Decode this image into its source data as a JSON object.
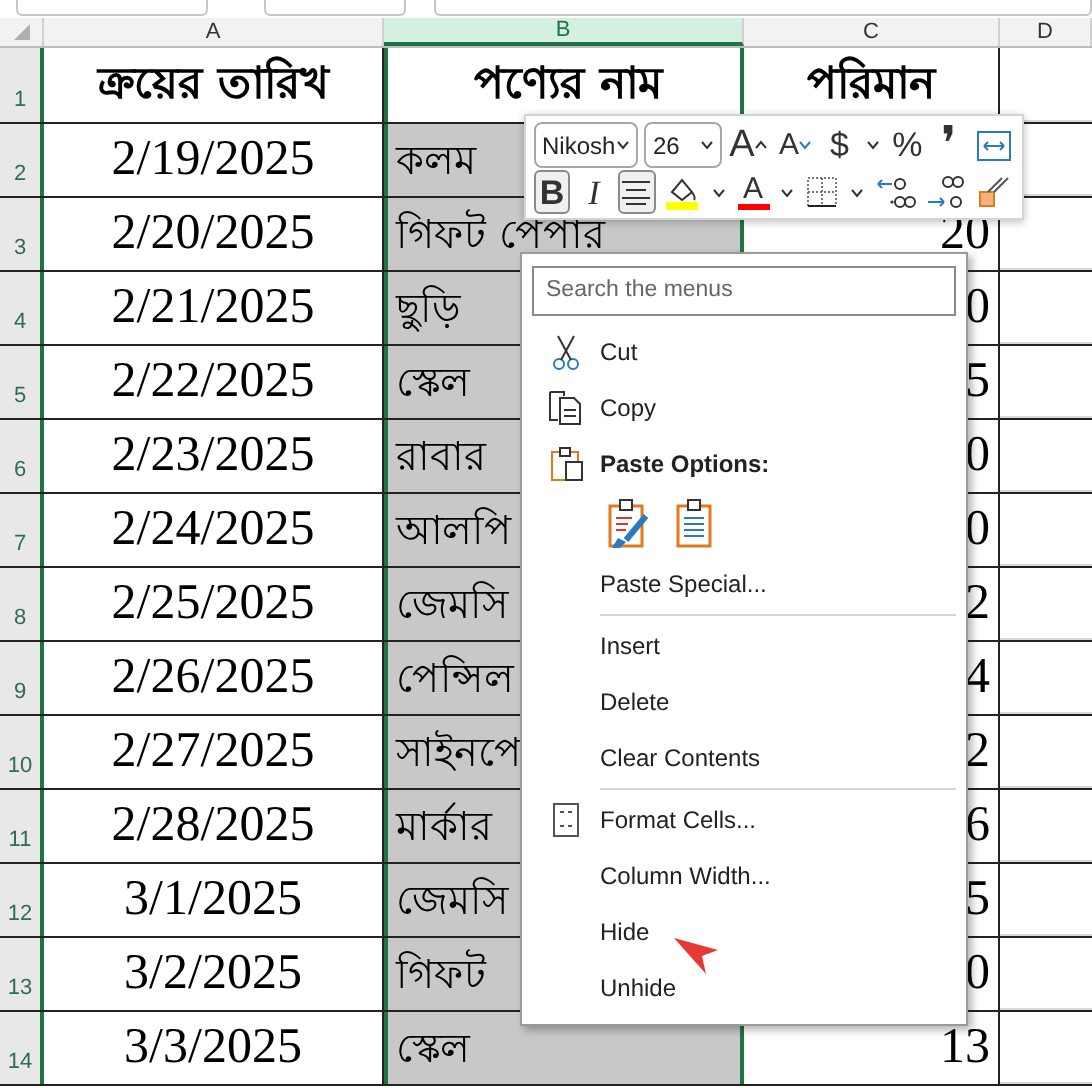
{
  "columns": [
    {
      "label": "A",
      "selected": false
    },
    {
      "label": "B",
      "selected": true
    },
    {
      "label": "C",
      "selected": false
    },
    {
      "label": "D",
      "selected": false
    }
  ],
  "rows": [
    {
      "number": "1",
      "cells": [
        "ক্রয়ের তারিখ",
        "পণ্যের নাম",
        "পরিমান"
      ],
      "kind": "heading"
    },
    {
      "number": "2",
      "cells": [
        "2/19/2025",
        "কলম",
        ""
      ],
      "kind": "data"
    },
    {
      "number": "3",
      "cells": [
        "2/20/2025",
        "গিফট পেপার",
        "20"
      ],
      "kind": "data"
    },
    {
      "number": "4",
      "cells": [
        "2/21/2025",
        "ছুড়ি",
        "0"
      ],
      "kind": "data"
    },
    {
      "number": "5",
      "cells": [
        "2/22/2025",
        "স্কেল",
        "5"
      ],
      "kind": "data"
    },
    {
      "number": "6",
      "cells": [
        "2/23/2025",
        "রাবার",
        "0"
      ],
      "kind": "data"
    },
    {
      "number": "7",
      "cells": [
        "2/24/2025",
        "আলপি",
        "0"
      ],
      "kind": "data"
    },
    {
      "number": "8",
      "cells": [
        "2/25/2025",
        "জেমসি",
        "2"
      ],
      "kind": "data"
    },
    {
      "number": "9",
      "cells": [
        "2/26/2025",
        "পেন্সিল",
        "4"
      ],
      "kind": "data"
    },
    {
      "number": "10",
      "cells": [
        "2/27/2025",
        "সাইনপে",
        "2"
      ],
      "kind": "data"
    },
    {
      "number": "11",
      "cells": [
        "2/28/2025",
        "মার্কার",
        "6"
      ],
      "kind": "data"
    },
    {
      "number": "12",
      "cells": [
        "3/1/2025",
        "জেমসি",
        "5"
      ],
      "kind": "data"
    },
    {
      "number": "13",
      "cells": [
        "3/2/2025",
        "গিফট",
        "0"
      ],
      "kind": "data"
    },
    {
      "number": "14",
      "cells": [
        "3/3/2025",
        "স্কেল",
        "13"
      ],
      "kind": "data"
    }
  ],
  "mini_toolbar": {
    "font": "Nikosh",
    "size": "26",
    "row_2": [
      {
        "kind": "text",
        "label": "B",
        "selected": true
      },
      {
        "kind": "text",
        "label": "I",
        "selected": false
      },
      {
        "kind": "align",
        "selected": true
      },
      {
        "kind": "fill",
        "color": "#ffff00"
      },
      {
        "kind": "caret"
      },
      {
        "kind": "fontcolor",
        "label": "A",
        "color": "#ff0000"
      },
      {
        "kind": "caret"
      },
      {
        "kind": "borders"
      },
      {
        "kind": "caret"
      },
      {
        "kind": "incdec"
      },
      {
        "kind": "decdec"
      },
      {
        "kind": "painter"
      }
    ],
    "row_1": [
      {
        "kind": "grow",
        "label": "A"
      },
      {
        "kind": "shrink",
        "label": "A"
      },
      {
        "kind": "text",
        "label": "$"
      },
      {
        "kind": "caret"
      },
      {
        "kind": "text",
        "label": "%"
      },
      {
        "kind": "text",
        "label": "❜"
      },
      {
        "kind": "wrap"
      }
    ]
  },
  "context_menu": {
    "search": {
      "placeholder": "Search the menus"
    },
    "items": [
      {
        "kind": "command",
        "label": "Cut"
      },
      {
        "kind": "command",
        "label": "Copy"
      },
      {
        "kind": "heading",
        "label": "Paste Options:"
      },
      {
        "kind": "icons"
      },
      {
        "kind": "command",
        "label": "Paste Special..."
      },
      {
        "kind": "separator"
      },
      {
        "kind": "command",
        "label": "Insert"
      },
      {
        "kind": "command",
        "label": "Delete"
      },
      {
        "kind": "command",
        "label": "Clear Contents"
      },
      {
        "kind": "separator"
      },
      {
        "kind": "command",
        "label": "Format Cells..."
      },
      {
        "kind": "command",
        "label": "Column Width..."
      },
      {
        "kind": "command",
        "label": "Hide"
      },
      {
        "kind": "command",
        "label": "Unhide"
      }
    ]
  }
}
